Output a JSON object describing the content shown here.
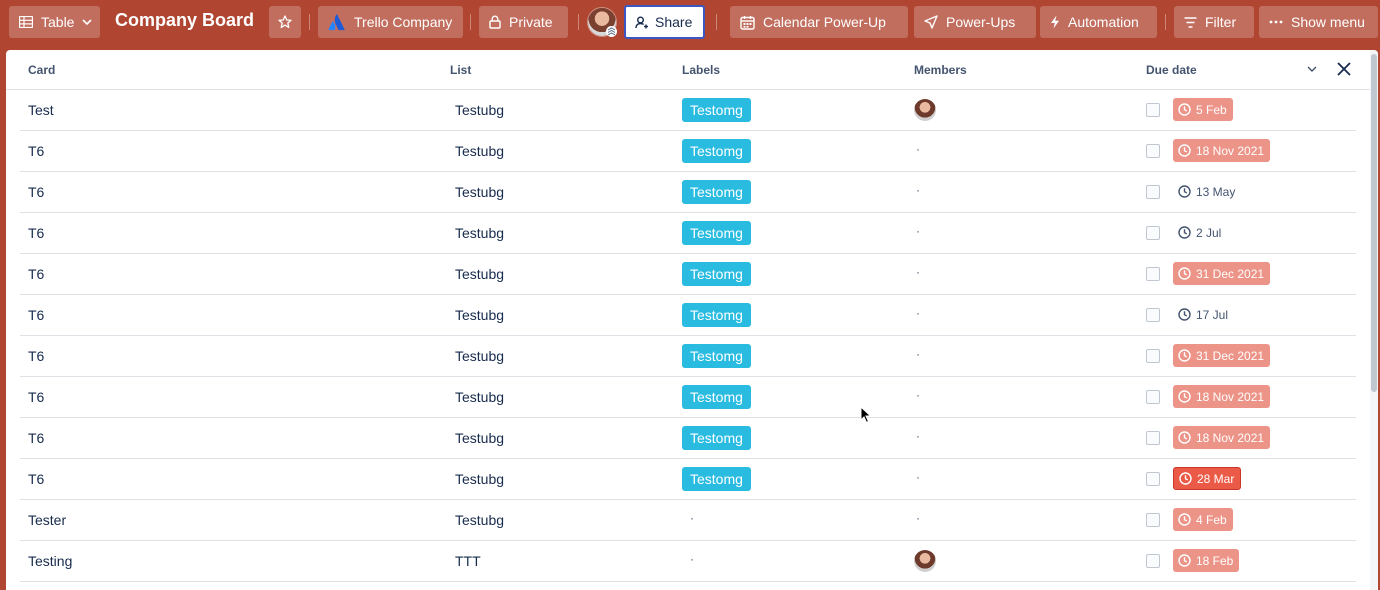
{
  "header": {
    "view_label": "Table",
    "board_title": "Company Board",
    "workspace_label": "Trello Company",
    "visibility_label": "Private",
    "share_label": "Share",
    "calendar_label": "Calendar Power-Up",
    "powerups_label": "Power-Ups",
    "automation_label": "Automation",
    "filter_label": "Filter",
    "menu_label": "Show menu"
  },
  "table": {
    "columns": {
      "card": "Card",
      "list": "List",
      "labels": "Labels",
      "members": "Members",
      "due": "Due date"
    },
    "rows": [
      {
        "card": "Test",
        "list": "Testubg",
        "label": "Testomg",
        "member": "avatar",
        "due": "5 Feb",
        "due_status": "overdue"
      },
      {
        "card": "T6",
        "list": "Testubg",
        "label": "Testomg",
        "member": "dot",
        "due": "18 Nov 2021",
        "due_status": "overdue"
      },
      {
        "card": "T6",
        "list": "Testubg",
        "label": "Testomg",
        "member": "dot",
        "due": "13 May",
        "due_status": "plain"
      },
      {
        "card": "T6",
        "list": "Testubg",
        "label": "Testomg",
        "member": "dot",
        "due": "2 Jul",
        "due_status": "plain"
      },
      {
        "card": "T6",
        "list": "Testubg",
        "label": "Testomg",
        "member": "dot",
        "due": "31 Dec 2021",
        "due_status": "overdue"
      },
      {
        "card": "T6",
        "list": "Testubg",
        "label": "Testomg",
        "member": "dot",
        "due": "17 Jul",
        "due_status": "plain"
      },
      {
        "card": "T6",
        "list": "Testubg",
        "label": "Testomg",
        "member": "dot",
        "due": "31 Dec 2021",
        "due_status": "overdue"
      },
      {
        "card": "T6",
        "list": "Testubg",
        "label": "Testomg",
        "member": "dot",
        "due": "18 Nov 2021",
        "due_status": "overdue"
      },
      {
        "card": "T6",
        "list": "Testubg",
        "label": "Testomg",
        "member": "dot",
        "due": "18 Nov 2021",
        "due_status": "overdue"
      },
      {
        "card": "T6",
        "list": "Testubg",
        "label": "Testomg",
        "member": "dot",
        "due": "28 Mar",
        "due_status": "soon"
      },
      {
        "card": "Tester",
        "list": "Testubg",
        "label": "",
        "member": "dot",
        "due": "4 Feb",
        "due_status": "overdue"
      },
      {
        "card": "Testing",
        "list": "TTT",
        "label": "",
        "member": "avatar",
        "due": "18 Feb",
        "due_status": "overdue"
      }
    ]
  },
  "colors": {
    "board_bg": "#b04632",
    "label_blue": "#29bbe0",
    "due_overdue": "#ec9488",
    "due_soon": "#eb5a46"
  },
  "icons": {
    "view": "table-icon",
    "star": "star-icon",
    "workspace": "atlassian-logo-icon",
    "visibility": "lock-icon",
    "share": "add-user-icon",
    "calendar": "calendar-icon",
    "powerups": "rocket-icon",
    "automation": "lightning-icon",
    "filter": "filter-icon",
    "menu": "ellipsis-icon",
    "collapse": "chevron-down-icon",
    "close": "close-icon",
    "due": "clock-icon"
  }
}
